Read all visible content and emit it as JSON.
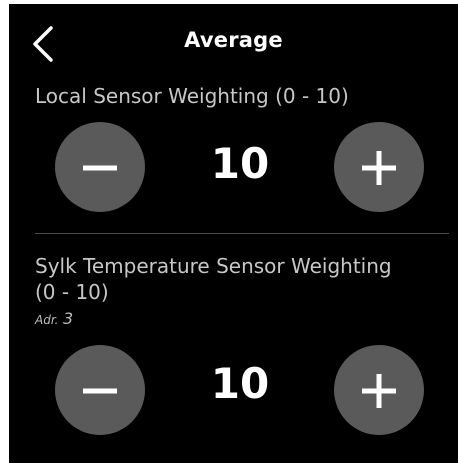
{
  "header": {
    "title": "Average",
    "back_icon": "chevron-left-icon"
  },
  "local_sensor": {
    "label": "Local Sensor Weighting (0 - 10)",
    "value": "10",
    "decrement_icon": "minus-icon",
    "increment_icon": "plus-icon"
  },
  "sylk_sensor": {
    "label_line1": "Sylk Temperature Sensor Weighting",
    "label_line2": "(0 - 10)",
    "address_prefix": "Adr.",
    "address_value": "3",
    "value": "10",
    "decrement_icon": "minus-icon",
    "increment_icon": "plus-icon"
  },
  "colors": {
    "background": "#000000",
    "button": "#5a5a5a",
    "text_primary": "#ffffff",
    "text_secondary": "#c7c7c7"
  }
}
